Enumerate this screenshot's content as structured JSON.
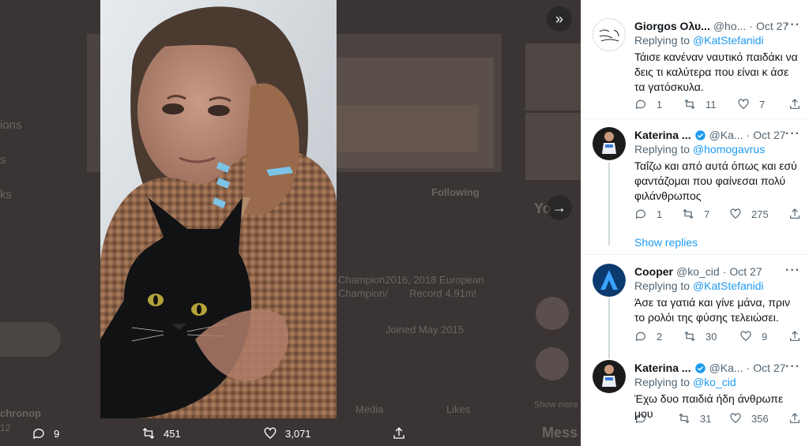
{
  "background": {
    "fragments": [
      "ions",
      "s",
      "ks",
      "Following",
      "Champion2016, 2018 European",
      "Champion/",
      "Record 4.91m!",
      "Joined May 2015",
      "Media",
      "Likes",
      "chronop",
      "12",
      "Mess",
      "Show more",
      "Yo"
    ]
  },
  "media_actions": {
    "reply_count": "9",
    "retweet_count": "451",
    "like_count": "3,071"
  },
  "replies": [
    {
      "name": "Giorgos Ολυ...",
      "handle": "@ho...",
      "date": "Oct 27",
      "replying_label": "Replying to",
      "replying_to": "@KatStefanidi",
      "text": "Τάισε κανέναν ναυτικό παιδάκι να δεις τι καλύτερα που είναι κ άσε τα γατόσκυλα.",
      "replies": "1",
      "retweets": "11",
      "likes": "7",
      "avatar": "sketch-avatar"
    },
    {
      "name": "Katerina ...",
      "handle": "@Ka...",
      "date": "Oct 27",
      "replying_label": "Replying to",
      "replying_to": "@homogavrus",
      "text": "Ταΐζω και από αυτά όπως και εσύ φαντάζομαι που φαίνεσαι πολύ φιλάνθρωπος",
      "replies": "1",
      "retweets": "7",
      "likes": "275",
      "verified": true,
      "avatar": "athlete-avatar"
    },
    {
      "name": "Cooper",
      "handle": "@ko_cid",
      "date": "Oct 27",
      "replying_label": "Replying to",
      "replying_to": "@KatStefanidi",
      "text": "Άσε τα γατιά και γίνε μάνα, πριν το ρολόι της φύσης τελειώσει.",
      "replies": "2",
      "retweets": "30",
      "likes": "9",
      "avatar": "letter-a-avatar"
    },
    {
      "name": "Katerina ...",
      "handle": "@Ka...",
      "date": "Oct 27",
      "replying_label": "Replying to",
      "replying_to": "@ko_cid",
      "text": "Έχω δυο παιδιά ήδη άνθρωπε μου",
      "replies": "",
      "retweets": "31",
      "likes": "356",
      "verified": true,
      "avatar": "athlete-avatar"
    }
  ],
  "show_replies": "Show replies",
  "colors": {
    "link": "#1d9bf0",
    "muted": "#536471",
    "text": "#0f1419",
    "overlay": "#3a3534"
  }
}
